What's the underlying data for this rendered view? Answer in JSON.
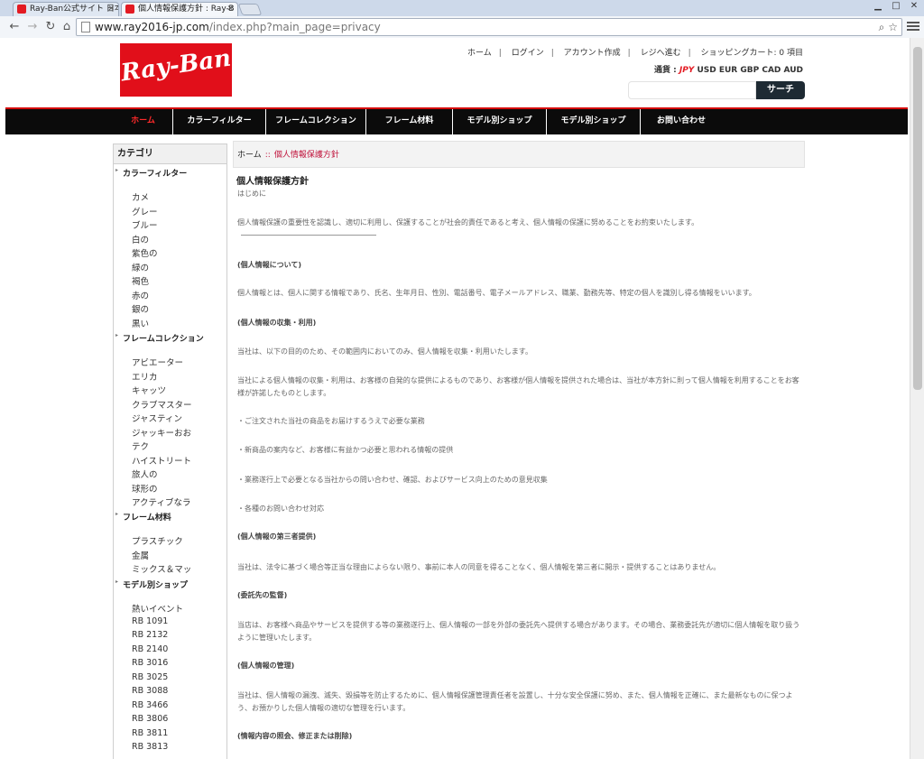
{
  "browser": {
    "tabs": [
      {
        "title": "Ray-Ban公式サイト 日本"
      },
      {
        "title": "個人情報保護方針 : Ray-B"
      }
    ],
    "url_host": "www.ray2016-jp.com",
    "url_path": "/index.php?main_page=privacy"
  },
  "header": {
    "logo_text": "Ray-Ban",
    "topnav": [
      "ホーム",
      "ログイン",
      "アカウント作成",
      "レジへ進む",
      "ショッピングカート: 0 項目"
    ],
    "currency_label": "通貨 :",
    "currencies": {
      "active": "JPY",
      "others": "USD EUR GBP CAD AUD"
    },
    "search_button": "サーチ"
  },
  "mainnav": [
    "ホーム",
    "カラーフィルター",
    "フレームコレクション",
    "フレーム材料",
    "モデル別ショップ",
    "モデル別ショップ",
    "お問い合わせ"
  ],
  "sidebar": {
    "title": "カテゴリ",
    "groups": [
      {
        "title": "カラーフィルター",
        "items": [
          "カメ",
          "グレー",
          "ブルー",
          "白の",
          "紫色の",
          "緑の",
          "褐色",
          "赤の",
          "銀の",
          "黒い"
        ]
      },
      {
        "title": "フレームコレクション",
        "items": [
          "アビエーター",
          "エリカ",
          "キャッツ",
          "クラブマスター",
          "ジャスティン",
          "ジャッキーおお",
          "テク",
          "ハイストリート",
          "旅人の",
          "球形の",
          "アクティブなラ"
        ]
      },
      {
        "title": "フレーム材料",
        "items": [
          "プラスチック",
          "金属",
          "ミックス＆マッ"
        ]
      },
      {
        "title": "モデル別ショップ",
        "items": [
          "熱いイベント",
          "RB 1091",
          "RB 2132",
          "RB 2140",
          "RB 3016",
          "RB 3025",
          "RB 3088",
          "RB 3466",
          "RB 3806",
          "RB 3811",
          "RB 3813"
        ]
      }
    ]
  },
  "content": {
    "breadcrumb": {
      "home": "ホーム",
      "sep": "::",
      "current": "個人情報保護方針"
    },
    "title": "個人情報保護方針",
    "intro": "はじめに",
    "p_intro": "個人情報保護の重要性を認識し、適切に利用し、保護することが社会的責任であると考え、個人情報の保護に努めることをお約束いたします。",
    "h1": "(個人情報について)",
    "p1": "個人情報とは、個人に関する情報であり、氏名、生年月日、性別、電話番号、電子メールアドレス、職業、勤務先等、特定の個人を識別し得る情報をいいます。",
    "h2": "(個人情報の収集・利用)",
    "p2a": "当社は、以下の目的のため、その範囲内においてのみ、個人情報を収集・利用いたします。",
    "p2b": "当社による個人情報の収集・利用は、お客様の自発的な提供によるものであり、お客様が個人情報を提供された場合は、当社が本方針に則って個人情報を利用することをお客様が許諾したものとします。",
    "b1": "・ご注文された当社の商品をお届けするうえで必要な業務",
    "b2": "・新商品の案内など、お客様に有益かつ必要と思われる情報の提供",
    "b3": "・業務遂行上で必要となる当社からの問い合わせ、確認、およびサービス向上のための意見収集",
    "b4": "・各種のお問い合わせ対応",
    "h3": "(個人情報の第三者提供)",
    "p3": "当社は、法令に基づく場合等正当な理由によらない限り、事前に本人の同意を得ることなく、個人情報を第三者に開示・提供することはありません。",
    "h4": "(委託先の監督)",
    "p4": "当店は、お客様へ商品やサービスを提供する等の業務遂行上、個人情報の一部を外部の委託先へ提供する場合があります。その場合、業務委託先が適切に個人情報を取り扱うように管理いたします。",
    "h5": "(個人情報の管理)",
    "p5": "当社は、個人情報の漏洩、滅失、毀損等を防止するために、個人情報保護管理責任者を設置し、十分な安全保護に努め、また、個人情報を正確に、また最新なものに保つよう、お預かりした個人情報の適切な管理を行います。",
    "h6": "(情報内容の照会、修正または削除)"
  }
}
